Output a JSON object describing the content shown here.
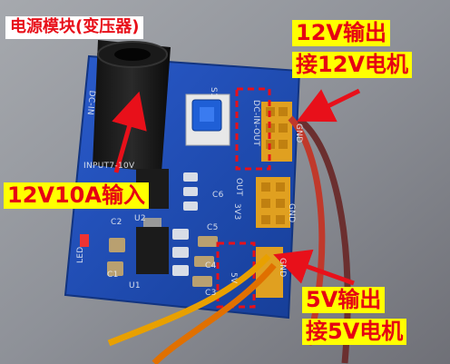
{
  "labels": {
    "title": "电源模块(变压器)",
    "out12_line1": "12V输出",
    "out12_line2": "接12V电机",
    "input": "12V10A输入",
    "out5_line1": "5V输出",
    "out5_line2": "接5V电机"
  },
  "silkscreen": {
    "dc_in": "DC-IN",
    "input_range": "INPUT7-10V",
    "s1": "S1",
    "dc_in_out": "DC-IN-OUT",
    "out": "OUT",
    "v3_3": "3V3",
    "v5": "5V",
    "gnd": "GND",
    "c6": "C6",
    "c5": "C5",
    "c4": "C4",
    "c3": "C3",
    "c1": "C1",
    "c2": "C2",
    "u1": "U1",
    "u2": "U2",
    "led": "LED"
  },
  "colors": {
    "board": "#1f4fb8",
    "label_background": "#ffff00",
    "label_text": "#e60012",
    "dashed_box": "#e8101a",
    "arrow": "#e8101a"
  }
}
